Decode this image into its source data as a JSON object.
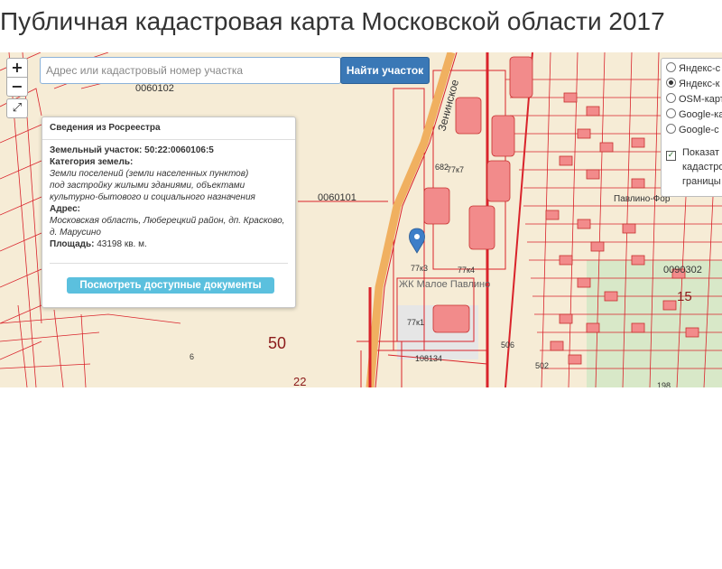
{
  "page": {
    "title": "Публичная кадастровая карта Московской области 2017"
  },
  "controls": {
    "zoom_in": "+",
    "zoom_out": "−",
    "fullscreen": "⤢"
  },
  "search": {
    "placeholder": "Адрес или кадастровый номер участка",
    "button_label": "Найти участок"
  },
  "popup": {
    "header": "Сведения из Росреестра",
    "parcel_label": "Земельный участок: 50:22:0060106:5",
    "category_label": "Категория земель:",
    "category_lines": [
      "Земли поселений (земли населенных пунктов)",
      "под застройку жилыми зданиями, объектами",
      "культурно-бытового и социального назначения"
    ],
    "address_label": "Адрес:",
    "address_lines": [
      "Московская область, Люберецкий район, дп. Красково,",
      "д. Марусино"
    ],
    "area_label": "Площадь:",
    "area_value": "43198 кв. м.",
    "docs_button": "Посмотреть доступные документы"
  },
  "layers": {
    "options": [
      {
        "label": "Яндекс-с",
        "checked": false
      },
      {
        "label": "Яндекс-к",
        "checked": true
      },
      {
        "label": "OSM-карт",
        "checked": false
      },
      {
        "label": "Google-ка",
        "checked": false
      },
      {
        "label": "Google-с",
        "checked": false
      }
    ],
    "show_boundaries": {
      "lines": [
        "Показат",
        "кадастро",
        "границы"
      ],
      "checked": true
    }
  },
  "map_labels": {
    "quarter_top": "0060102",
    "quarter_mid": "0060101",
    "quarter_right": "0090302",
    "street": "Зенинское",
    "district_50": "50",
    "num_22": "22",
    "num_6": "6",
    "num_15": "15",
    "complex": "ЖК Малое Павлино",
    "b77k3": "77к3",
    "b77k4": "77к4",
    "b77k1": "77к1",
    "b77k7": "77к7",
    "b682": "682",
    "road_num": "108134",
    "place": "Павлино-Фор",
    "b198": "198",
    "b502": "502",
    "b506": "506"
  },
  "colors": {
    "map_bg": "#f6ecd6",
    "parcel_line": "#d9232b",
    "building_fill": "#f28b8b",
    "road": "#f0b060",
    "accent_button": "#3a78b6",
    "docs_button": "#5bc0de",
    "marker": "#3d7ec8"
  }
}
